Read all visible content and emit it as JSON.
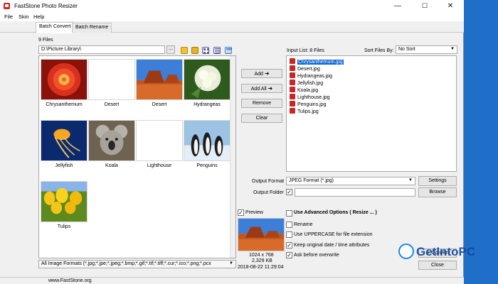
{
  "window": {
    "title": "FastStone Photo Resizer",
    "controls": {
      "minimize": "—",
      "maximize": "☐",
      "close": "✕"
    }
  },
  "menu": [
    "File",
    "Skin",
    "Help"
  ],
  "tabs": [
    "Batch Convert",
    "Batch Rename"
  ],
  "browser": {
    "files_count": "9 Files",
    "path": "D:\\Picture Library\\",
    "browse_label": "...",
    "thumbnails": [
      {
        "label": "Chrysanthemum",
        "image": "red-flower"
      },
      {
        "label": "Desert",
        "image": "blank"
      },
      {
        "label": "Desert",
        "image": "desert"
      },
      {
        "label": "Hydrangeas",
        "image": "white-flower"
      },
      {
        "label": "Jellyfish",
        "image": "jellyfish"
      },
      {
        "label": "Koala",
        "image": "koala"
      },
      {
        "label": "Lighthouse",
        "image": "blank"
      },
      {
        "label": "Penguins",
        "image": "penguins"
      },
      {
        "label": "Tulips",
        "image": "tulips"
      }
    ],
    "filter": "All Image Formats (*.jpg;*.jpe;*.jpeg;*.bmp;*.gif;*.tif;*.tiff;*.cur;*.ico;*.png;*.pcx"
  },
  "actions": {
    "add": "Add",
    "add_all": "Add All",
    "remove": "Remove",
    "clear": "Clear"
  },
  "input_list": {
    "header": "Input List: 8 Files",
    "sort_label": "Sort Files By:",
    "sort_value": "No Sort",
    "files": [
      "Chrysanthemum.jpg",
      "Desert.jpg",
      "Hydrangeas.jpg",
      "Jellyfish.jpg",
      "Koala.jpg",
      "Lighthouse.jpg",
      "Penguins.jpg",
      "Tulips.jpg"
    ],
    "selected_index": 0
  },
  "output": {
    "format_label": "Output Format",
    "format_value": "JPEG Format (*.jpg)",
    "settings_label": "Settings",
    "folder_label": "Output Folder",
    "folder_value": "",
    "browse_label": "Browse"
  },
  "preview": {
    "label": "Preview",
    "checked": true,
    "dimensions": "1024 x 768",
    "size": "2,329 KB",
    "date": "2018-08-22 11:29:04"
  },
  "options": {
    "advanced": {
      "label": "Use Advanced Options ( Resize ... )",
      "checked": false
    },
    "rename": {
      "label": "Rename",
      "checked": false
    },
    "uppercase": {
      "label": "Use UPPERCASE for file extension",
      "checked": false
    },
    "keep_date": {
      "label": "Keep original date / time attributes",
      "checked": true
    },
    "ask_overwrite": {
      "label": "Ask before overwrite",
      "checked": true
    }
  },
  "buttons": {
    "convert": "Convert",
    "close": "Close"
  },
  "status": {
    "website": "www.FastStone.org"
  },
  "watermark": {
    "text": "GetIntoPC"
  },
  "colors": {
    "accent": "#0a64d6",
    "desktop": "#1f6fc9",
    "window_bg": "#f0f0f0",
    "arrow_green": "#2e9e2e"
  }
}
